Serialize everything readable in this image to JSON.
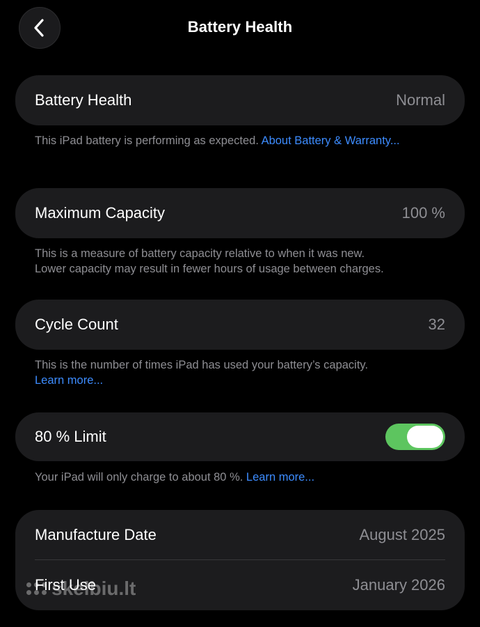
{
  "header": {
    "title": "Battery Health"
  },
  "battery_health": {
    "label": "Battery Health",
    "value": "Normal",
    "footnote_text": "This iPad battery is performing as expected. ",
    "footnote_link": "About Battery & Warranty..."
  },
  "maximum_capacity": {
    "label": "Maximum Capacity",
    "value": "100 %",
    "footnote_line1": "This is a measure of battery capacity relative to when it was new.",
    "footnote_line2": "Lower capacity may result in fewer hours of usage between charges."
  },
  "cycle_count": {
    "label": "Cycle Count",
    "value": "32",
    "footnote_text": "This is the number of times iPad has used your battery’s capacity.",
    "footnote_link": "Learn more..."
  },
  "limit_80": {
    "label": "80 % Limit",
    "enabled": true,
    "footnote_text": "Your iPad will only charge to about 80 %. ",
    "footnote_link": "Learn more..."
  },
  "manufacture": {
    "manufacture_label": "Manufacture Date",
    "manufacture_value": "August 2025",
    "first_use_label": "First Use",
    "first_use_value": "January 2026"
  },
  "watermark": {
    "text": "skelbiu.lt"
  },
  "colors": {
    "background": "#000000",
    "card": "#1c1c1e",
    "secondary_text": "#8e8e93",
    "link": "#3d8cff",
    "toggle_on": "#5dc55f"
  },
  "icons": {
    "back": "chevron-left-icon"
  }
}
